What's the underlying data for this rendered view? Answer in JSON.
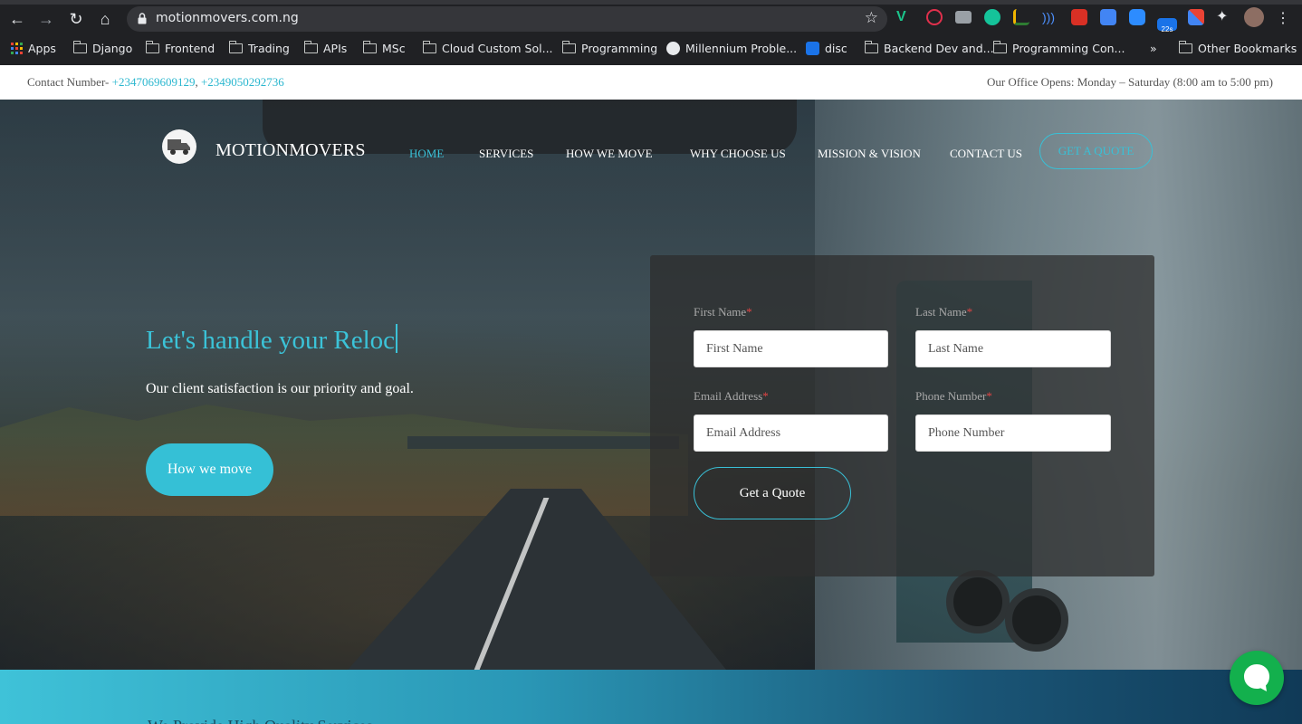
{
  "browser": {
    "url": "motionmovers.com.ng",
    "extension_badge": "22s",
    "bookmarks": [
      {
        "label": "Apps",
        "icon": "apps-grid-icon"
      },
      {
        "label": "Django",
        "icon": "folder-icon"
      },
      {
        "label": "Frontend",
        "icon": "folder-icon"
      },
      {
        "label": "Trading",
        "icon": "folder-icon"
      },
      {
        "label": "APIs",
        "icon": "folder-icon"
      },
      {
        "label": "MSc",
        "icon": "folder-icon"
      },
      {
        "label": "Cloud Custom Sol...",
        "icon": "folder-icon"
      },
      {
        "label": "Programming",
        "icon": "folder-icon"
      },
      {
        "label": "Millennium Proble...",
        "icon": "site-icon"
      },
      {
        "label": "disc",
        "icon": "flag-icon"
      },
      {
        "label": "Backend Dev and...",
        "icon": "folder-icon"
      },
      {
        "label": "Programming Con...",
        "icon": "folder-icon"
      },
      {
        "label": "»",
        "icon": ""
      },
      {
        "label": "Other Bookmarks",
        "icon": "folder-icon"
      }
    ]
  },
  "topbar": {
    "contact_prefix": "Contact Number-",
    "phone1": "+2347069609129",
    "separator": ",",
    "phone2": "+2349050292736",
    "hours": "Our Office Opens: Monday – Saturday (8:00 am to 5:00 pm)"
  },
  "nav": {
    "brand": "MOTIONMOVERS",
    "items": [
      "HOME",
      "SERVICES",
      "HOW WE MOVE",
      "WHY CHOOSE US",
      "MISSION & VISION",
      "CONTACT US"
    ],
    "quote_button": "GET A QUOTE"
  },
  "hero": {
    "headline": "Let's handle your Reloc",
    "tagline": "Our client satisfaction is our priority and goal.",
    "button": "How we move"
  },
  "form": {
    "first_name_label": "First Name",
    "first_name_placeholder": "First Name",
    "last_name_label": "Last Name",
    "last_name_placeholder": "Last Name",
    "email_label": "Email Address",
    "email_placeholder": "Email Address",
    "phone_label": "Phone Number",
    "phone_placeholder": "Phone Number",
    "required_mark": "*",
    "submit": "Get a Quote"
  },
  "band": {
    "heading": "We Provide High Quality Services"
  },
  "colors": {
    "accent": "#39c0d6",
    "chat": "#13b04d",
    "required": "#e24545"
  }
}
